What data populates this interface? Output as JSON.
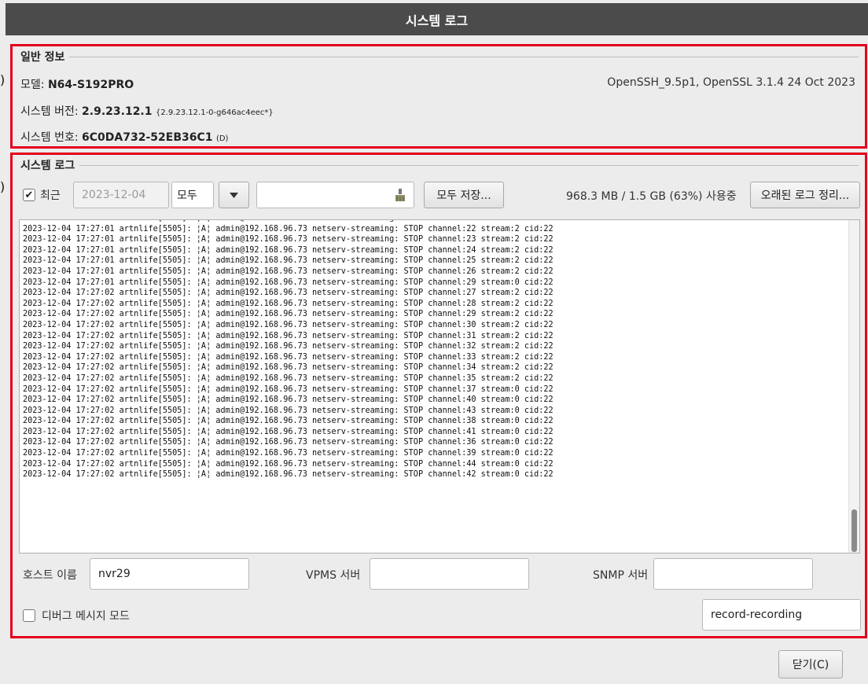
{
  "window": {
    "title": "시스템 로그"
  },
  "general": {
    "title": "일반 정보",
    "model_label": "모델:",
    "model_value": "N64-S192PRO",
    "ssl_info": "OpenSSH_9.5p1, OpenSSL 3.1.4 24 Oct 2023",
    "version_label": "시스템 버전:",
    "version_value": "2.9.23.12.1",
    "version_detail": "{2.9.23.12.1-0-g646ac4eec*}",
    "serial_label": "시스템 번호:",
    "serial_value": "6C0DA732-52EB36C1",
    "serial_suffix": "(D)"
  },
  "syslog": {
    "title": "시스템 로그",
    "recent_checked": true,
    "recent_label": "최근",
    "date_value": "2023-12-04",
    "filter_value": "모두",
    "search_value": "",
    "save_all_label": "모두 저장...",
    "usage_text": "968.3 MB / 1.5 GB (63%) 사용중",
    "cleanup_label": "오래된 로그 정리...",
    "log_lines": [
      "2023-12-04 17:27:01 artnlife[5505]: ¦A¦ admin@192.168.96.73 netserv-streaming: STOP channel:21 stream:2 cid:22",
      "2023-12-04 17:27:01 artnlife[5505]: ¦A¦ admin@192.168.96.73 netserv-streaming: STOP channel:22 stream:2 cid:22",
      "2023-12-04 17:27:01 artnlife[5505]: ¦A¦ admin@192.168.96.73 netserv-streaming: STOP channel:23 stream:2 cid:22",
      "2023-12-04 17:27:01 artnlife[5505]: ¦A¦ admin@192.168.96.73 netserv-streaming: STOP channel:24 stream:2 cid:22",
      "2023-12-04 17:27:01 artnlife[5505]: ¦A¦ admin@192.168.96.73 netserv-streaming: STOP channel:25 stream:2 cid:22",
      "2023-12-04 17:27:01 artnlife[5505]: ¦A¦ admin@192.168.96.73 netserv-streaming: STOP channel:26 stream:2 cid:22",
      "2023-12-04 17:27:01 artnlife[5505]: ¦A¦ admin@192.168.96.73 netserv-streaming: STOP channel:29 stream:0 cid:22",
      "2023-12-04 17:27:02 artnlife[5505]: ¦A¦ admin@192.168.96.73 netserv-streaming: STOP channel:27 stream:2 cid:22",
      "2023-12-04 17:27:02 artnlife[5505]: ¦A¦ admin@192.168.96.73 netserv-streaming: STOP channel:28 stream:2 cid:22",
      "2023-12-04 17:27:02 artnlife[5505]: ¦A¦ admin@192.168.96.73 netserv-streaming: STOP channel:29 stream:2 cid:22",
      "2023-12-04 17:27:02 artnlife[5505]: ¦A¦ admin@192.168.96.73 netserv-streaming: STOP channel:30 stream:2 cid:22",
      "2023-12-04 17:27:02 artnlife[5505]: ¦A¦ admin@192.168.96.73 netserv-streaming: STOP channel:31 stream:2 cid:22",
      "2023-12-04 17:27:02 artnlife[5505]: ¦A¦ admin@192.168.96.73 netserv-streaming: STOP channel:32 stream:2 cid:22",
      "2023-12-04 17:27:02 artnlife[5505]: ¦A¦ admin@192.168.96.73 netserv-streaming: STOP channel:33 stream:2 cid:22",
      "2023-12-04 17:27:02 artnlife[5505]: ¦A¦ admin@192.168.96.73 netserv-streaming: STOP channel:34 stream:2 cid:22",
      "2023-12-04 17:27:02 artnlife[5505]: ¦A¦ admin@192.168.96.73 netserv-streaming: STOP channel:35 stream:2 cid:22",
      "2023-12-04 17:27:02 artnlife[5505]: ¦A¦ admin@192.168.96.73 netserv-streaming: STOP channel:37 stream:0 cid:22",
      "2023-12-04 17:27:02 artnlife[5505]: ¦A¦ admin@192.168.96.73 netserv-streaming: STOP channel:40 stream:0 cid:22",
      "2023-12-04 17:27:02 artnlife[5505]: ¦A¦ admin@192.168.96.73 netserv-streaming: STOP channel:43 stream:0 cid:22",
      "2023-12-04 17:27:02 artnlife[5505]: ¦A¦ admin@192.168.96.73 netserv-streaming: STOP channel:38 stream:0 cid:22",
      "2023-12-04 17:27:02 artnlife[5505]: ¦A¦ admin@192.168.96.73 netserv-streaming: STOP channel:41 stream:0 cid:22",
      "2023-12-04 17:27:02 artnlife[5505]: ¦A¦ admin@192.168.96.73 netserv-streaming: STOP channel:36 stream:0 cid:22",
      "2023-12-04 17:27:02 artnlife[5505]: ¦A¦ admin@192.168.96.73 netserv-streaming: STOP channel:39 stream:0 cid:22",
      "2023-12-04 17:27:02 artnlife[5505]: ¦A¦ admin@192.168.96.73 netserv-streaming: STOP channel:44 stream:0 cid:22",
      "2023-12-04 17:27:02 artnlife[5505]: ¦A¦ admin@192.168.96.73 netserv-streaming: STOP channel:42 stream:0 cid:22"
    ],
    "hostname_label": "호스트 이름",
    "hostname_value": "nvr29",
    "vpms_label": "VPMS 서버",
    "vpms_value": "",
    "snmp_label": "SNMP 서버",
    "snmp_value": "",
    "debug_checked": false,
    "debug_label": "디버그 메시지 모드",
    "record_value": "record-recording"
  },
  "footer": {
    "close_label": "닫기(C)"
  },
  "icons": {
    "search": "broom-icon",
    "dropdown": "caret-down-icon",
    "check": "checkmark-icon"
  },
  "colors": {
    "highlight_border": "#e3001b",
    "titlebar": "#4b4b4b"
  }
}
